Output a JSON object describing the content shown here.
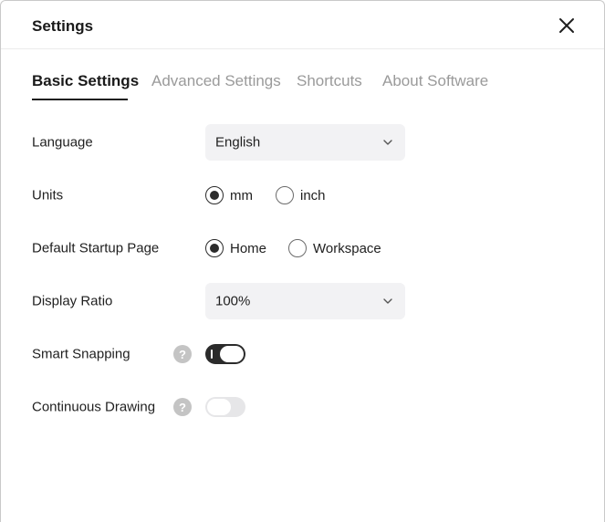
{
  "dialog": {
    "title": "Settings",
    "close_icon": "close-icon"
  },
  "tabs": [
    {
      "label": "Basic Settings",
      "active": true
    },
    {
      "label": "Advanced Settings",
      "active": false
    },
    {
      "label": "Shortcuts",
      "active": false
    },
    {
      "label": "About Software",
      "active": false
    }
  ],
  "settings": {
    "language": {
      "label": "Language",
      "value": "English",
      "icon": "chevron-down-icon"
    },
    "units": {
      "label": "Units",
      "options": [
        {
          "label": "mm",
          "checked": true
        },
        {
          "label": "inch",
          "checked": false
        }
      ]
    },
    "startup_page": {
      "label": "Default Startup Page",
      "options": [
        {
          "label": "Home",
          "checked": true
        },
        {
          "label": "Workspace",
          "checked": false
        }
      ]
    },
    "display_ratio": {
      "label": "Display Ratio",
      "value": "100%",
      "icon": "chevron-down-icon"
    },
    "smart_snapping": {
      "label": "Smart Snapping",
      "help": "?",
      "enabled": true
    },
    "continuous_drawing": {
      "label": "Continuous Drawing",
      "help": "?",
      "enabled": false
    }
  },
  "colors": {
    "accent": "#2b2b2b",
    "inactive_tab": "#9a9a9a",
    "select_bg": "#f2f2f4",
    "help_icon": "#c4c4c4",
    "toggle_off": "#e6e6e8"
  }
}
